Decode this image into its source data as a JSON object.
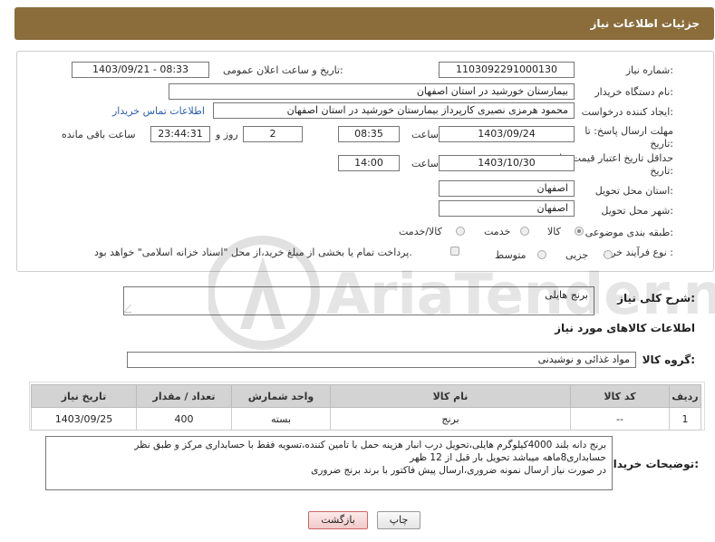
{
  "header": {
    "title": "جزئیات اطلاعات نیاز"
  },
  "form": {
    "need_number_label": "شماره نیاز:",
    "need_number": "1103092291000130",
    "announce_label": "تاریخ و ساعت اعلان عمومی:",
    "announce_value": "1403/09/21 - 08:33",
    "buyer_org_label": "نام دستگاه خریدار:",
    "buyer_org": "بیمارستان خورشید در استان اصفهان",
    "creator_label": "ایجاد کننده درخواست:",
    "creator": "محمود هرمزی نصیری کارپرداز بیمارستان خورشید در استان اصفهان",
    "contact_link": "اطلاعات تماس خریدار",
    "reply_deadline_label": "مهلت ارسال پاسخ: تا تاریخ:",
    "reply_date": "1403/09/24",
    "time_label": "ساعت",
    "reply_time": "08:35",
    "days_value": "2",
    "days_label": "روز و",
    "remaining_time": "23:44:31",
    "remaining_label": "ساعت باقی مانده",
    "price_validity_label": "حداقل تاریخ اعتبار قیمت: تا تاریخ:",
    "price_date": "1403/10/30",
    "price_time": "14:00",
    "province_label": "استان محل تحویل:",
    "province": "اصفهان",
    "city_label": "شهر محل تحویل:",
    "city": "اصفهان",
    "category_label": "طبقه بندی موضوعی:",
    "category_options": [
      "کالا",
      "خدمت",
      "کالا/خدمت"
    ],
    "category_selected": "کالا",
    "process_label": "نوع فرآیند خرید :",
    "process_options": [
      "جزیی",
      "متوسط"
    ],
    "payment_note": "پرداخت تمام یا بخشی از مبلغ خرید،از محل \"اسناد خزانه اسلامی\" خواهد بود."
  },
  "summary": {
    "label": "شرح کلی نیاز:",
    "value": "برنج هایلی",
    "items_title": "اطلاعات کالاهای مورد نیاز",
    "group_label": "گروه کالا:",
    "group_value": "مواد غذائی و نوشیدنی"
  },
  "table": {
    "headers": [
      "ردیف",
      "کد کالا",
      "نام کالا",
      "واحد شمارش",
      "تعداد / مقدار",
      "تاریخ نیاز"
    ],
    "rows": [
      [
        "1",
        "--",
        "برنج",
        "بسته",
        "400",
        "1403/09/25"
      ]
    ]
  },
  "buyer_notes": {
    "label": "توضیحات خریدار:",
    "lines": [
      "برنج دانه بلند 4000کیلوگرم هایلی،تحویل درب انبار هزینه حمل با تامین کننده،تسویه فقط با حسابداری مرکز و طبق نظر",
      "حسابداری8ماهه میباشد تحویل بار قبل از 12 ظهر",
      "در صورت نیاز ارسال نمونه ضروری،ارسال پیش فاکتور با برند برنج ضروری"
    ]
  },
  "buttons": {
    "print": "چاپ",
    "back": "بازگشت"
  },
  "watermark": {
    "text": "AriaTender.neT"
  }
}
